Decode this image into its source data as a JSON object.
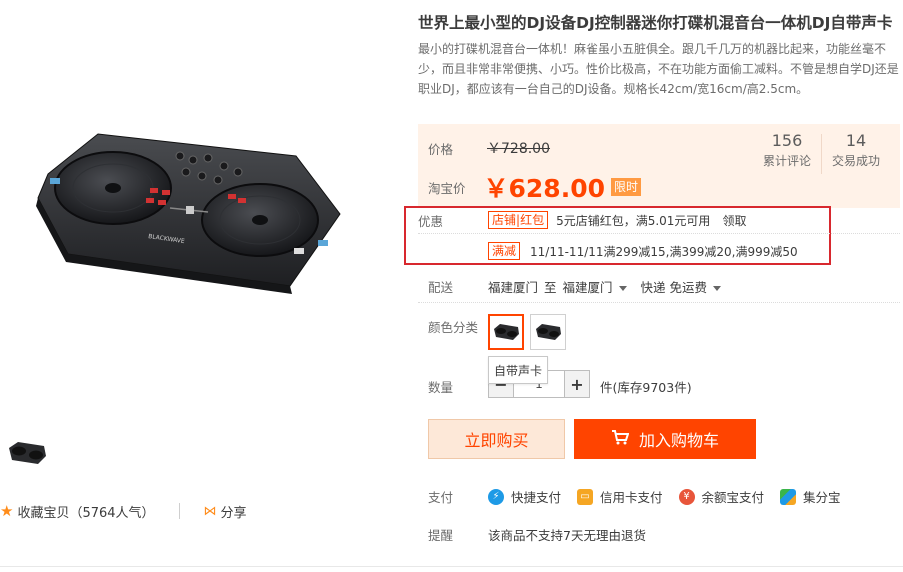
{
  "product": {
    "title": "世界上最小型的DJ设备DJ控制器迷你打碟机混音台一体机DJ自带声卡",
    "subtitle": "最小的打碟机混音台一体机！麻雀虽小五脏俱全。跟几千几万的机器比起来，功能丝毫不少，而且非常非常便携、小巧。性价比极高，不在功能方面偷工减料。不管是想自学DJ还是职业DJ，都应该有一台自己的DJ设备。规格长42cm/宽16cm/高2.5cm。"
  },
  "price": {
    "label": "价格",
    "original": "￥728.00",
    "promo_label": "淘宝价",
    "current": "￥628.00",
    "badge": "限时"
  },
  "stats": [
    {
      "value": "156",
      "label": "累计评论"
    },
    {
      "value": "14",
      "label": "交易成功"
    }
  ],
  "promo": {
    "label": "优惠",
    "line1_tag": "店铺",
    "line1_tag2": "红包",
    "line1_text": "5元店铺红包，满5.01元可用",
    "line1_action": "领取",
    "line2_tag": "满减",
    "line2_text": "11/11-11/11满299减15,满399减20,满999减50"
  },
  "delivery": {
    "label": "配送",
    "from": "福建厦门",
    "to_word": "至",
    "to": "福建厦门",
    "method": "快递 免运费"
  },
  "color": {
    "label": "颜色分类",
    "tooltip": "自带声卡"
  },
  "quantity": {
    "label": "数量",
    "value": "1",
    "stock": "件(库存9703件)"
  },
  "buttons": {
    "buy": "立即购买",
    "cart": "加入购物车"
  },
  "payment": {
    "label": "支付",
    "methods": [
      "快捷支付",
      "信用卡支付",
      "余额宝支付",
      "集分宝"
    ]
  },
  "remind": {
    "label": "提醒",
    "text": "该商品不支持7天无理由退货"
  },
  "favorites": {
    "text": "收藏宝贝（5764人气）",
    "share": "分享"
  },
  "colors": {
    "accent": "#ff4400",
    "price_bg": "#fff2e8",
    "highlight_box": "#d8282e"
  }
}
